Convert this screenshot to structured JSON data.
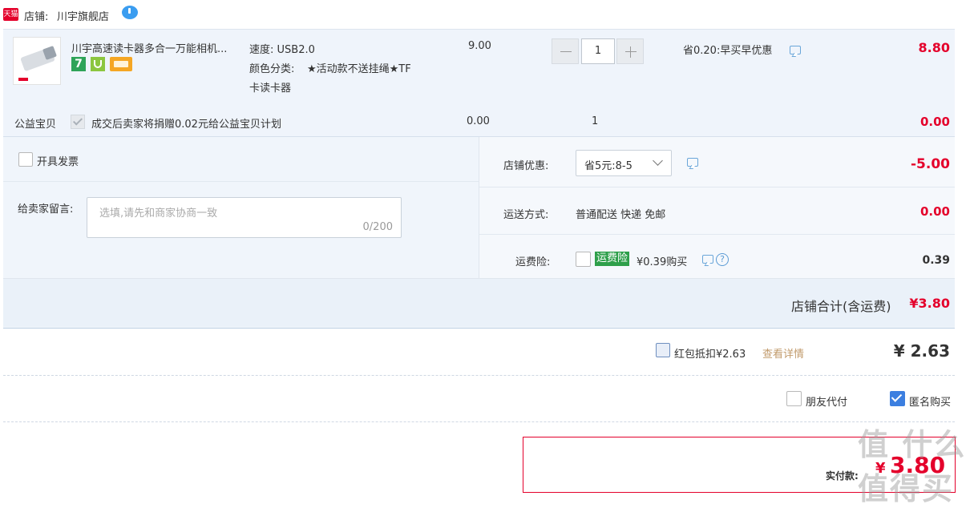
{
  "shop": {
    "tmall_badge": "天猫",
    "label": "店铺:",
    "name": "川宇旗舰店",
    "chat_icon": "chat-bubble-icon"
  },
  "item": {
    "title": "川宇高速读卡器多合一万能相机...",
    "tag_seven": "7",
    "spec_speed": "速度: USB2.0",
    "spec_color_label": "颜色分类:",
    "spec_color_value": "★活动款不送挂绳★TF",
    "spec_color_value2": "卡读卡器",
    "price": "9.00",
    "quantity": "1",
    "discount": "省0.20:早买早优惠",
    "subtotal": "8.80"
  },
  "charity": {
    "label": "公益宝贝",
    "desc": "成交后卖家将捐赠0.02元给公益宝贝计划",
    "price": "0.00",
    "qty": "1",
    "subtotal": "0.00"
  },
  "invoice": {
    "label": "开具发票"
  },
  "message": {
    "label": "给卖家留言:",
    "placeholder": "选填,请先和商家协商一致",
    "counter": "0/200"
  },
  "shop_discount": {
    "label": "店铺优惠:",
    "selected": "省5元:8-5",
    "amount": "-5.00"
  },
  "shipping": {
    "label": "运送方式:",
    "value": "普通配送 快递 免邮",
    "amount": "0.00"
  },
  "insurance": {
    "label": "运费险:",
    "badge": "运费险",
    "desc": "¥0.39购买",
    "amount": "0.39"
  },
  "shop_total": {
    "label": "店铺合计(含运费)",
    "amount": "¥3.80"
  },
  "redpacket": {
    "label": "红包抵扣¥2.63",
    "link": "查看详情",
    "amount": "¥ 2.63"
  },
  "options": {
    "friend_pay": "朋友代付",
    "anonymous": "匿名购买"
  },
  "pay": {
    "label": "实付款:",
    "currency": "¥",
    "amount": "3.80"
  },
  "watermark": "值 什么值得买",
  "colors": {
    "accent": "#e4002b",
    "panel": "#eff4fb",
    "link": "#c19a6b",
    "badge_green": "#2e9f4a"
  }
}
